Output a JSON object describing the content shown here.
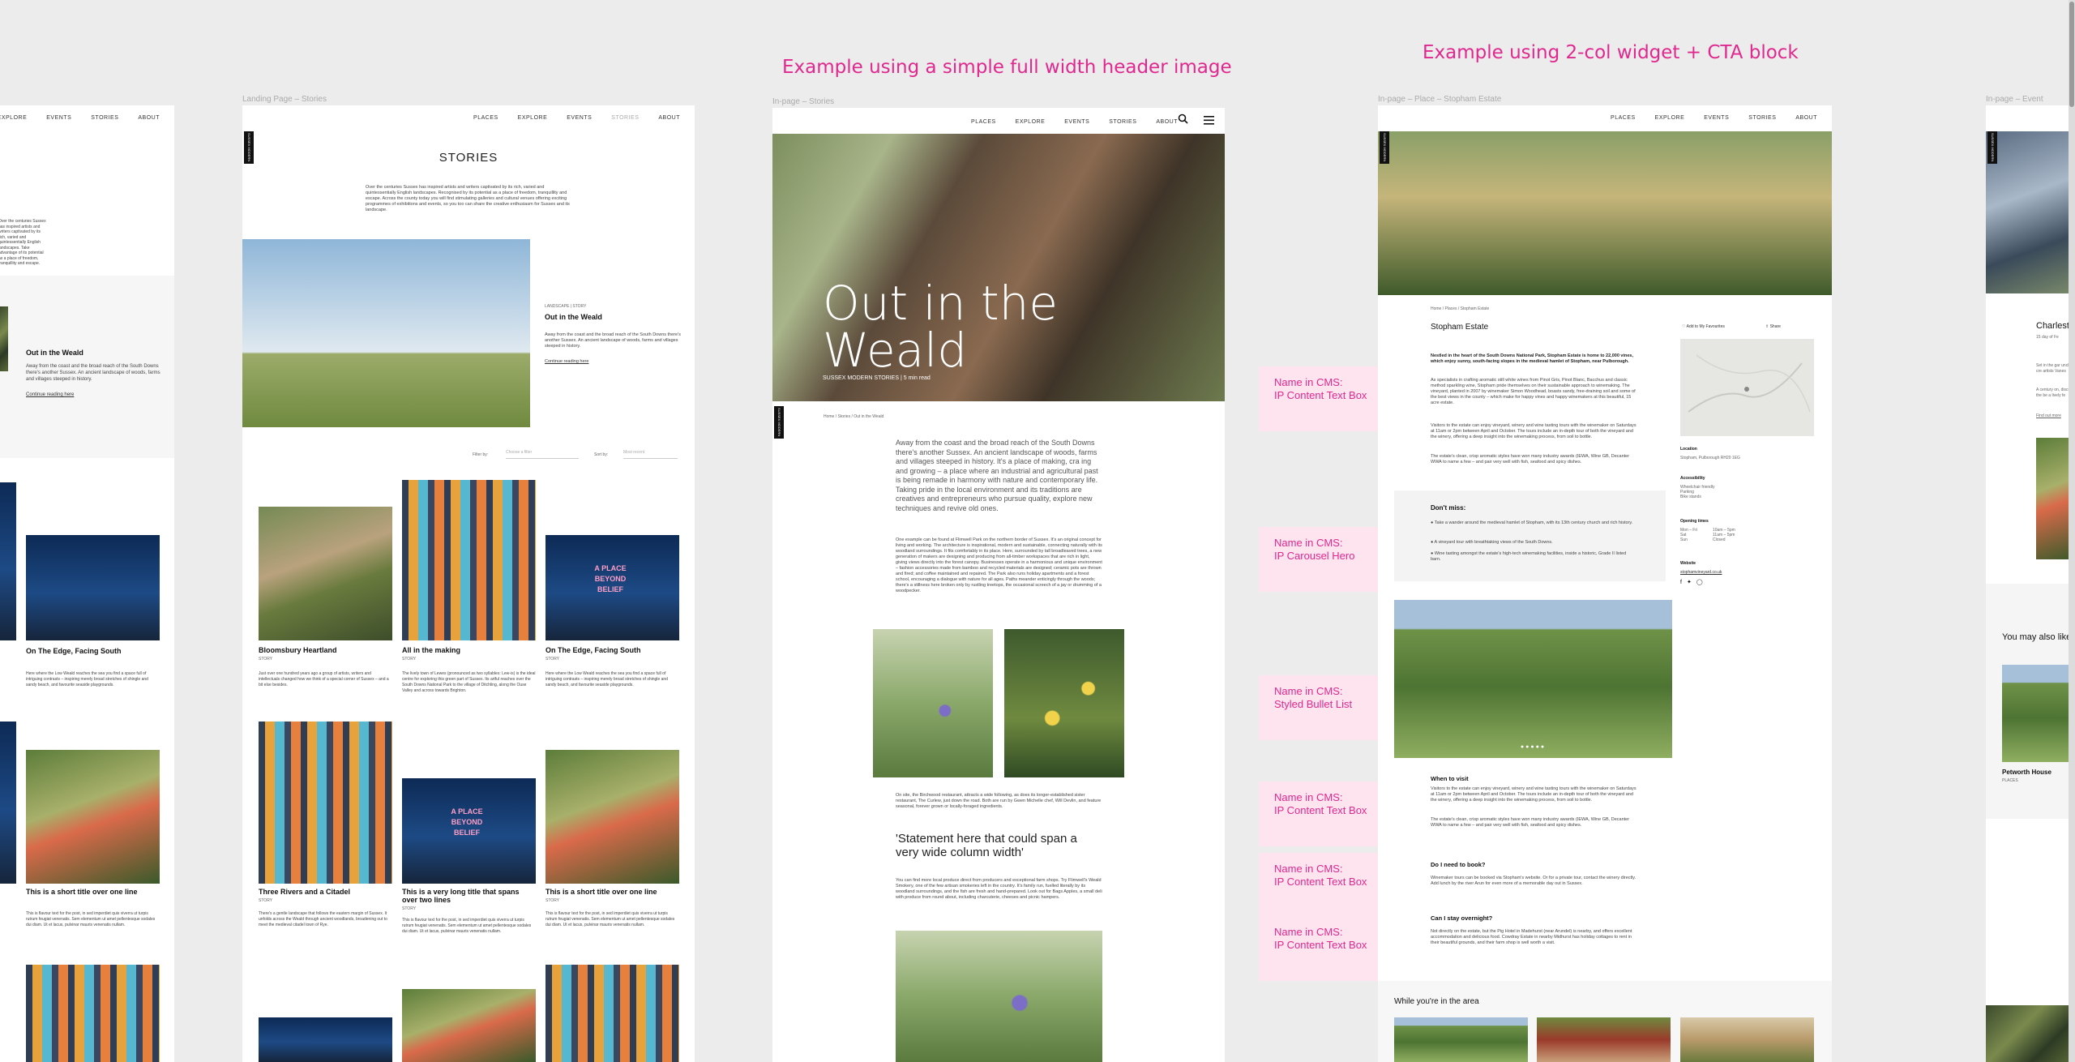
{
  "headings": {
    "full_width": "Example using a simple full width header image",
    "two_col": "Example using 2-col widget + CTA block"
  },
  "frame_labels": {
    "landing": "Landing Page – Stories",
    "inpage": "In-page – Stories",
    "place": "In-page – Place – Stopham Estate",
    "event": "In-page – Event"
  },
  "nav": [
    "PLACES",
    "EXPLORE",
    "EVENTS",
    "STORIES",
    "ABOUT"
  ],
  "logo": "SUSSEX MODERN",
  "left_partial": {
    "card_title": "Out in the Weald",
    "card_text": "Away from the coast and the broad reach of the South Downs there's another Sussex. An ancient landscape of woods, farms and villages steeped in history.",
    "card_link": "Continue reading here",
    "edge_text": "Over the centuries Sussex has inspired artists and writers captivated by its rich, varied and quintessentially English landscapes. Take advantage of its potential as a place of freedom, tranquillity and escape.",
    "grid_title_1": "On The Edge, Facing South",
    "grid_title_2": "This is a short title over one line",
    "grid_text": "Here where the Low Weald reaches the sea you find a space full of intriguing contrasts – inspiring merely broad stretches of shingle and sandy beach, and favourite seaside playgrounds.",
    "grid_text_2": "This is flavour text for the post, in sed imperdiet quis viverra ut turpis rutrum feugiat venenatis. Sem elementum ut amet pellentesque sodales dui diam. Ut et lacus, pulvinar mauris venenatis nullam."
  },
  "landing": {
    "title": "STORIES",
    "intro": "Over the centuries Sussex has inspired artists and writers captivated by its rich, varied and quintessentially English landscapes. Recognised by its potential as a place of freedom, tranquillity and escape. Across the county today you will find stimulating galleries and cultural venues offering exciting programmes of exhibitions and events, so you too can share the creative enthusiasm for Sussex and its landscape.",
    "feature": {
      "tag": "LANDSCAPE | STORY",
      "title": "Out in the Weald",
      "text": "Away from the coast and the broad reach of the South Downs there's another Sussex. An ancient landscape of woods, farms and villages steeped in history.",
      "link": "Continue reading here"
    },
    "filter_label": "Filter by:",
    "filter_placeholder": "Choose a filter",
    "sort_label": "Sort by:",
    "sort_value": "Most recent",
    "cards": [
      {
        "title": "Bloomsbury Heartland",
        "tag": "STORY",
        "text": "Just over one hundred years ago a group of artists, writers and intellectuals changed how we think of a special corner of Sussex – and a bit else besides."
      },
      {
        "title": "All in the making",
        "tag": "STORY",
        "text": "The lively town of Lewes (pronounced as two syllables: Lew-is) is the ideal centre for exploring this green part of Sussex. Its artful reaches over the South Downs National Park to the village of Ditchling, along the Ouse Valley and across towards Brighton."
      },
      {
        "title": "On The Edge, Facing South",
        "tag": "STORY",
        "text": "Here where the Low Weald reaches the sea you find a space full of intriguing contrasts – inspiring merely broad stretches of shingle and sandy beach, and favourite seaside playgrounds."
      },
      {
        "title": "Three Rivers and a Citadel",
        "tag": "STORY",
        "text": "There's a gentle landscape that follows the eastern margin of Sussex. It unfolds across the Weald through ancient woodlands, broadening out to meet the medieval citadel town of Rye."
      },
      {
        "title": "This is a very long title that spans over two lines",
        "tag": "STORY",
        "text": "This is flavour text for the post, in sed imperdiet quis viverra ut turpis rutrum feugiat venenatis. Sem elementum ut amet pellentesque sodales dui diam. Ut et lacus, pulvinar mauris venenatis nullam."
      },
      {
        "title": "This is a short title over one line",
        "tag": "STORY",
        "text": "This is flavour text for the post, in sed imperdiet quis viverra ut turpis rutrum feugiat venenatis. Sem elementum ut amet pellentesque sodales dui diam. Ut et lacus, pulvinar mauris venenatis nullam."
      }
    ],
    "sign_text": "A PLACE BEYOND BELIEF"
  },
  "inpage": {
    "hero_title": "Out in the Weald",
    "hero_sub": "SUSSEX MODERN STORIES",
    "hero_meta": "5 min read",
    "breadcrumb": "Home  /  Stories  /  Out in the Weald",
    "lead": "Away from the coast and the broad reach of the South Downs there's another Sussex. An ancient landscape of woods, farms and villages steeped in history. It's a place of making, cra   ing and growing – a place where an industrial and agricultural past is being remade in harmony with nature and contemporary life. Taking pride in the local environment and its traditions are creatives and entrepreneurs who pursue quality, explore new techniques and revive old ones.",
    "para1": "One example can be found at Flimwell Park on the northern border of Sussex. It's an original concept for living and working. The architecture is inspirational, modern and sustainable, connecting naturally with its woodland surroundings. It fits comfortably in its place. Here, surrounded by tall broadleaved trees, a new generation of makers are designing and producing from all-timber workspaces that are rich in light, giving views directly into the forest canopy. Businesses operate in a harmonious and unique environment – fashion accessories made from bamboo and recycled materials are designed; ceramic pots are thrown and fired; and coffee maintained and repaired. The Park also runs holiday apartments and a forest school, encouraging a dialogue with nature for all ages. Paths meander enticingly through the woods; there's a stillness here broken only by rustling treetops, the occasional screech of a jay or drumming of a woodpecker.",
    "para2": "On site, the Birchwood restaurant, attracts a wide following, as does its longer-established sister restaurant, The Curlew, just down the road. Both are run by Gwen Michelle chef, Will Devlin, and feature seasonal, forever grown or locally-foraged ingredients.",
    "quote": "'Statement here that could span a very wide column width'",
    "para3": "You can find more local produce direct from producers and exceptional farm shops. Try Flimwell's Weald Smokery, one of the few artisan smokeries left in the country. It's family run, fuelled literally by its woodland surroundings, and the fish are fresh and hand-prepared. Look out for Bags Apples, a small deli with produce from round about, including charcuterie, cheeses and picnic hampers."
  },
  "place": {
    "breadcrumb": "Home  /  Places  /  Stopham Estate",
    "title": "Stopham Estate",
    "fav": "Add to My Favourites",
    "share": "Share",
    "intro": "Nestled in the heart of the South Downs National Park, Stopham Estate is home to 22,000 vines, which enjoy sunny, south-facing slopes in the medieval hamlet of Stopham, near Pulborough.",
    "p1": "As specialists in crafting aromatic still white wines from Pinot Gris, Pinot Blanc, Bacchus and classic method sparkling wine, Stopham pride themselves on their sustainable approach to winemaking. The vineyard, planted in 2007 by winemaker Simon Woodhead, boasts sandy, free-draining soil and some of the best views in the county – which make for happy vines and happy winemakers at this beautiful, 15 acre estate.",
    "p2": "Visitors to the estate can enjoy vineyard, winery and wine tasting tours with the winemaker on Saturdays at 11am or 2pm between April and October. The tours include an in-depth tour of both the vineyard and the winery, offering a deep insight into the winemaking process, from soil to bottle.",
    "p3": "The estate's clean, crisp aromatic styles have won many industry awards (IEWA, Wine GB, Decanter WWA to name a few – and pair very well with fish, seafood and spicy dishes.",
    "dont_miss_title": "Don't miss:",
    "dont_miss": [
      "Take a wander around the medieval hamlet of Stopham, with its 13th century church and rich history.",
      "A vineyard tour with breathtaking views of the South Downs.",
      "Wine tasting amongst the estate's high-tech winemaking facilities, inside a historic, Grade II listed barn."
    ],
    "when_title": "When to visit",
    "when_p1": "Visitors to the estate can enjoy vineyard, winery and wine tasting tours with the winemaker on Saturdays at 11am or 2pm between April and October. The tours include an in-depth tour of both the vineyard and the winery, offering a deep insight into the winemaking process, from soil to bottle.",
    "when_p2": "The estate's clean, crisp aromatic styles have won many industry awards (IEWA, Wine GB, Decanter WWA to name a few – and pair very well with fish, seafood and spicy dishes.",
    "book_title": "Do I need to book?",
    "book_p": "Winemaker tours can be booked via Stopham's website. Or for a private tour, contact the winery directly. Add lunch by the river Arun for even more of a memorable day out in Sussex.",
    "stay_title": "Can I stay overnight?",
    "stay_p": "Not directly on the estate, but the Pig Hotel in Madehurst (near Arundel) is nearby, and offers excellent accommodation and delicious food. Cowdray Estate in nearby Midhurst has holiday cottages to rent in their beautiful grounds, and their farm shop is well worth a visit.",
    "side": {
      "location_label": "Location",
      "location": "Stopham, Pulborough RH20 1EG",
      "access_label": "Accessibility",
      "access": [
        "Wheelchair friendly",
        "Parking",
        "Bike stands"
      ],
      "open_label": "Opening times",
      "open": [
        [
          "Mon – Fri",
          "10am – 5pm"
        ],
        [
          "Sat",
          "11am – 5pm"
        ],
        [
          "Sun",
          "Closed"
        ]
      ],
      "website_label": "Website",
      "website": "stophamvineyard.co.uk"
    },
    "while_title": "While you're in the area"
  },
  "cms_labels": [
    {
      "line1": "Name in CMS:",
      "line2": "IP Content Text Box"
    },
    {
      "line1": "Name in CMS:",
      "line2": "IP Carousel Hero"
    },
    {
      "line1": "Name in CMS:",
      "line2": "Styled Bullet List"
    },
    {
      "line1": "Name in CMS:",
      "line2": "IP Content Text Box"
    },
    {
      "line1": "Name in CMS:",
      "line2": "IP Content Text Box"
    },
    {
      "line1": "Name in CMS:",
      "line2": "IP Content Text Box"
    }
  ],
  "event": {
    "title": "Charlest",
    "sub": "15 day of Fe",
    "text": "Set in the gar unchanged cre artists Vanes",
    "text2": "A century on, discussing the be a lively fe",
    "link": "Find out more",
    "also": "You may also like",
    "card": "Petworth House",
    "card_meta": "PLACES"
  },
  "colors": {
    "accent": "#e0288f",
    "bubble": "#fde4ee"
  }
}
